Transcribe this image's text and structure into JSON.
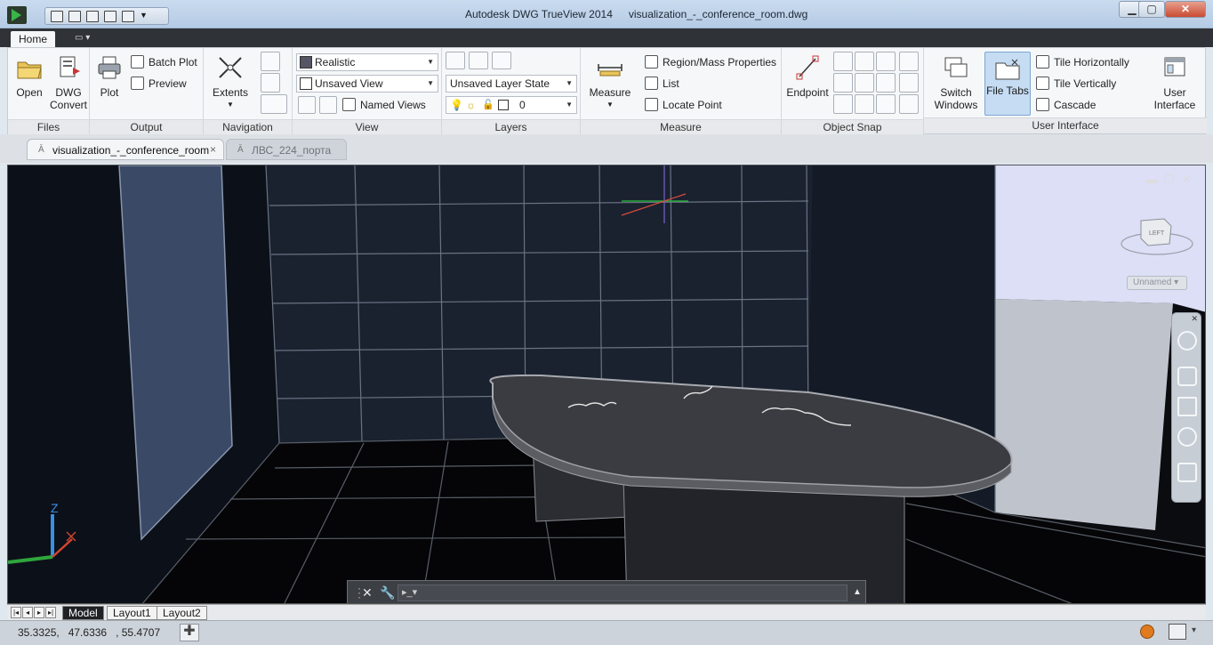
{
  "window": {
    "app_name": "Autodesk DWG TrueView 2014",
    "file_name": "visualization_-_conference_room.dwg",
    "minimize_label": "▁",
    "maximize_label": "▢",
    "close_label": "✕"
  },
  "ribbon_tabs": {
    "home": "Home"
  },
  "panels": {
    "files": {
      "label": "Files",
      "open": "Open",
      "dwg_convert_1": "DWG",
      "dwg_convert_2": "Convert"
    },
    "output": {
      "label": "Output",
      "plot": "Plot",
      "batch_plot": "Batch Plot",
      "preview": "Preview"
    },
    "navigation": {
      "label": "Navigation",
      "extents": "Extents"
    },
    "view": {
      "label": "View",
      "visual_style": "Realistic",
      "saved_view": "Unsaved View",
      "named_views": "Named Views"
    },
    "layers": {
      "label": "Layers",
      "layer_state": "Unsaved Layer State",
      "current_layer": "0"
    },
    "measure": {
      "label": "Measure",
      "measure": "Measure",
      "region_mass": "Region/Mass Properties",
      "list": "List",
      "locate_point": "Locate Point"
    },
    "object_snap": {
      "label": "Object Snap",
      "endpoint": "Endpoint"
    },
    "user_interface": {
      "label": "User Interface",
      "switch_windows_1": "Switch",
      "switch_windows_2": "Windows",
      "file_tabs": "File Tabs",
      "tile_horizontally": "Tile Horizontally",
      "tile_vertically": "Tile Vertically",
      "cascade": "Cascade",
      "user_interface_1": "User",
      "user_interface_2": "Interface"
    }
  },
  "doc_tabs": [
    {
      "label": "visualization_-_conference_room",
      "close": "×"
    },
    {
      "label": "ЛВС_224_порта"
    }
  ],
  "viewport": {
    "viewcube_face": "LEFT",
    "ucs_name": "Unnamed",
    "axis_z": "Z"
  },
  "layout_tabs": [
    "Model",
    "Layout1",
    "Layout2"
  ],
  "status": {
    "coordinates": "35.3325,   47.6336   , 55.4707"
  },
  "colors": {
    "ribbon_bg": "#f6f7f9",
    "titlebar": "#c9dbef",
    "viewport_bg": "#0b0c10",
    "active_tool": "#c5dcf3"
  }
}
